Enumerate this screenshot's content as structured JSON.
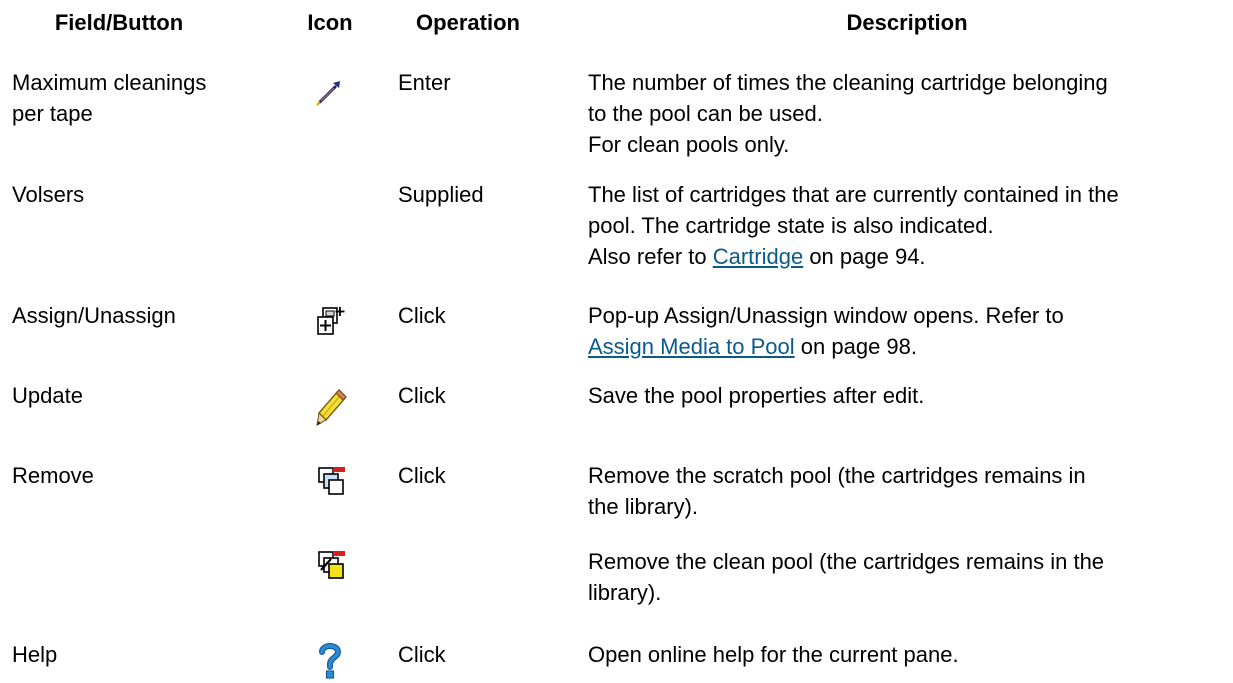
{
  "headers": {
    "field": "Field/Button",
    "icon": "Icon",
    "operation": "Operation",
    "description": "Description"
  },
  "rows": [
    {
      "field_lines": [
        "Maximum cleanings",
        "per tape"
      ],
      "icon": "eyedropper-icon",
      "operation": "Enter",
      "desc_lines": [
        "The number of times the cleaning cartridge belonging",
        "to the pool can be used.",
        "For clean pools only."
      ]
    },
    {
      "field_lines": [
        "Volsers"
      ],
      "icon": "",
      "operation": "Supplied",
      "desc_lines": [
        "The list of cartridges that are currently contained in the",
        "pool. The cartridge state is also indicated."
      ],
      "desc_ref": {
        "pre": "Also refer to ",
        "link": "Cartridge",
        "post": " on page 94."
      }
    },
    {
      "field_lines": [
        "Assign/Unassign"
      ],
      "icon": "assign-media-icon",
      "operation": "Click",
      "desc_lines": [
        "Pop-up Assign/Unassign window opens. Refer to"
      ],
      "desc_ref": {
        "pre": "",
        "link": "Assign Media to Pool",
        "post": " on page 98."
      }
    },
    {
      "field_lines": [
        "Update"
      ],
      "icon": "pencil-icon",
      "operation": "Click",
      "desc_lines": [
        "Save the pool properties after edit."
      ]
    },
    {
      "field_lines": [
        "Remove"
      ],
      "icon": "remove-scratch-pool-icon",
      "operation": "Click",
      "desc_lines": [
        "Remove the scratch pool (the cartridges remains in",
        "the library)."
      ]
    },
    {
      "field_lines": [],
      "icon": "remove-clean-pool-icon",
      "operation": "",
      "desc_lines": [
        "Remove the clean pool (the cartridges remains in the",
        "library)."
      ]
    },
    {
      "field_lines": [
        "Help"
      ],
      "icon": "help-question-icon",
      "operation": "Click",
      "desc_lines": [
        "Open online help for the current pane."
      ]
    }
  ],
  "colors": {
    "link": "#0b5a8c",
    "help_icon": "#2a8bd0",
    "remove_mark": "#d81e1e",
    "clean_pool_fill": "#f2e21a",
    "pencil_body": "#f5dd3a"
  }
}
